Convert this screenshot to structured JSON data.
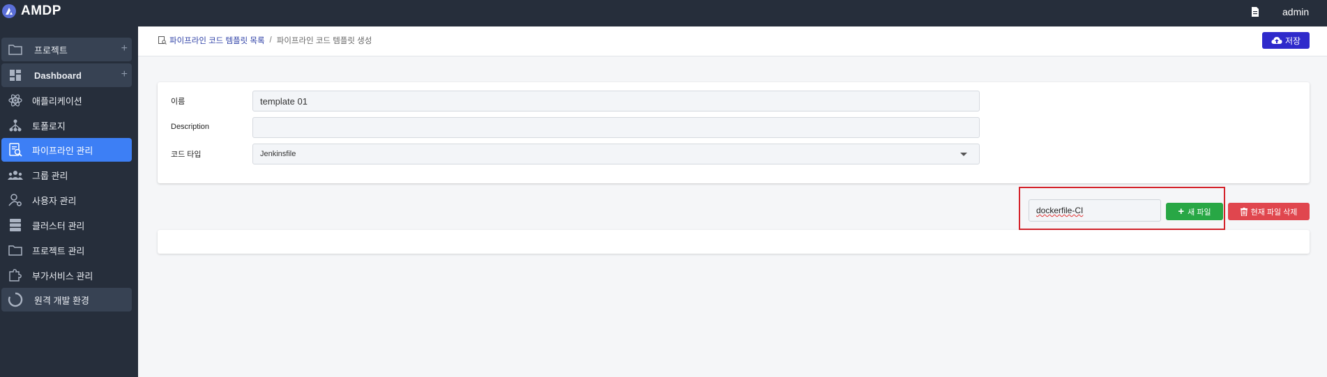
{
  "app": {
    "name": "AMDP"
  },
  "topbar": {
    "doc_icon": "document-icon",
    "user": "admin"
  },
  "sidebar": {
    "items": [
      {
        "label": "프로젝트",
        "icon": "folder-icon",
        "plus": "+"
      },
      {
        "label": "Dashboard",
        "icon": "dashboard-icon",
        "plus": "+"
      },
      {
        "label": "애플리케이션",
        "icon": "atom-icon"
      },
      {
        "label": "토폴로지",
        "icon": "topology-icon"
      },
      {
        "label": "파이프라인 관리",
        "icon": "pipeline-icon"
      },
      {
        "label": "그룹 관리",
        "icon": "group-icon"
      },
      {
        "label": "사용자 관리",
        "icon": "user-gear-icon"
      },
      {
        "label": "클러스터 관리",
        "icon": "server-icon"
      },
      {
        "label": "프로젝트 관리",
        "icon": "folder-icon"
      },
      {
        "label": "부가서비스 관리",
        "icon": "puzzle-gear-icon"
      },
      {
        "label": "원격 개발 환경",
        "icon": "loading-ring-icon"
      }
    ],
    "active": "파이프라인 관리"
  },
  "breadcrumb": {
    "link": "파이프라인 코드 템플릿 목록",
    "separator": "/",
    "current": "파이프라인 코드 템플릿 생성"
  },
  "toolbar": {
    "save_label": "저장"
  },
  "form": {
    "name_label": "이름",
    "name_value": "template 01",
    "description_label": "Description",
    "description_value": "",
    "code_type_label": "코드 타입",
    "code_type_value": "Jenkinsfile"
  },
  "files": {
    "file_name_value": "dockerfile-CI",
    "new_file_label": "새 파일",
    "delete_file_label": "현재 파일 삭제"
  },
  "colors": {
    "topbar": "#262e3b",
    "sidebar_active": "#3d7ff5",
    "save_button": "#2f2acb",
    "new_button": "#28a745",
    "delete_button": "#e0464e",
    "highlight_box": "#d4222a"
  }
}
